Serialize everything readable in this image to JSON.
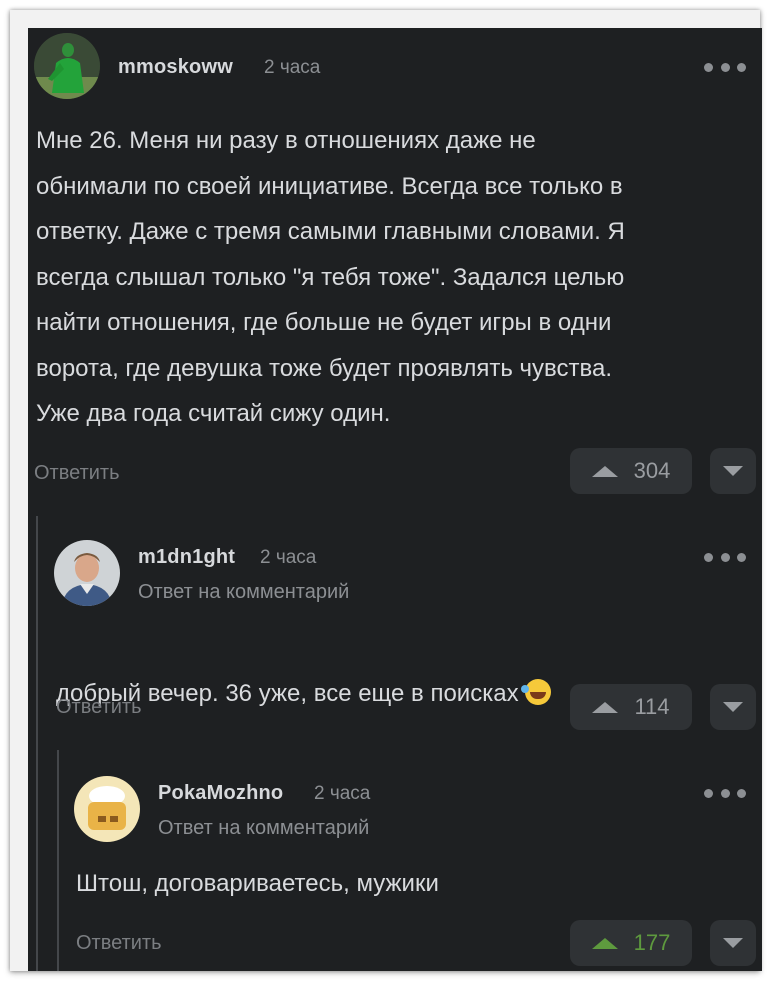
{
  "comments": [
    {
      "username": "mmoskoww",
      "time": "2 часа",
      "text": "Мне 26. Меня ни разу в отношениях даже не\nобнимали по своей инициативе. Всегда все только в\nответку. Даже с тремя самыми главными словами. Я\nвсегда слышал только \"я тебя тоже\". Задался целью\nнайти отношения, где больше не будет игры в одни\nворота, где девушка тоже будет проявлять чувства.\nУже два года считай сижу один.",
      "reply_label": "Ответить",
      "votes": "304"
    },
    {
      "username": "m1dn1ght",
      "time": "2 часа",
      "reply_note": "Ответ на комментарий",
      "text": "добрый вечер. 36 уже, все еще в поисках",
      "emoji": "rofl-emoji",
      "reply_label": "Ответить",
      "votes": "114"
    },
    {
      "username": "PokaMozhno",
      "time": "2 часа",
      "reply_note": "Ответ на комментарий",
      "text": "Штош, договариваетесь, мужики",
      "reply_label": "Ответить",
      "votes": "177",
      "voted": true
    }
  ],
  "colors": {
    "background": "#1e2022",
    "vote_active": "#5e9a3e"
  },
  "icons": [
    "more-dots-icon",
    "upvote-icon",
    "downvote-icon"
  ]
}
